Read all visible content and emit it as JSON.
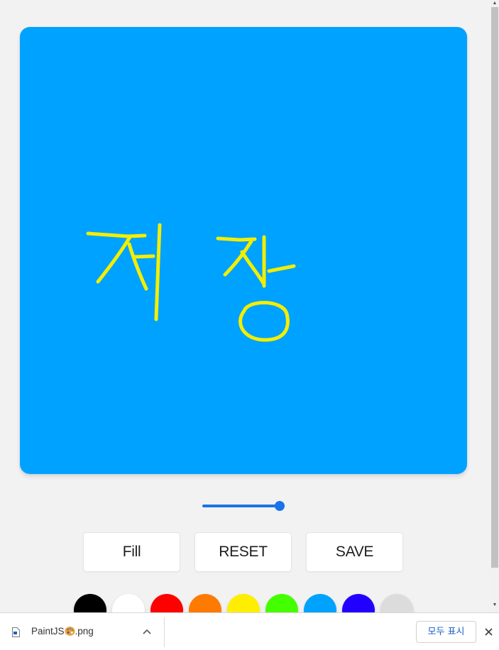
{
  "canvas": {
    "background": "#00a2ff",
    "stroke_color": "#f3ee00",
    "drawn_text": "저장"
  },
  "brush_range": {
    "value_fraction": 1.0
  },
  "controls": {
    "fill_label": "Fill",
    "reset_label": "RESET",
    "save_label": "SAVE"
  },
  "palette": {
    "colors": [
      "#000000",
      "#ffffff",
      "#ff0000",
      "#ff7a00",
      "#ffee00",
      "#44ff00",
      "#00a2ff",
      "#2200ff",
      "#dcdcdc"
    ]
  },
  "download_bar": {
    "file_name_prefix": "PaintJS",
    "file_name_emoji": "palette-emoji",
    "file_name_suffix": ".png",
    "show_all_label": "모두 표시"
  },
  "icons": {
    "file": "file-icon",
    "chevron": "chevron-up-icon",
    "close": "close-icon",
    "scroll_up": "scroll-up-arrow",
    "scroll_down": "scroll-down-arrow"
  }
}
